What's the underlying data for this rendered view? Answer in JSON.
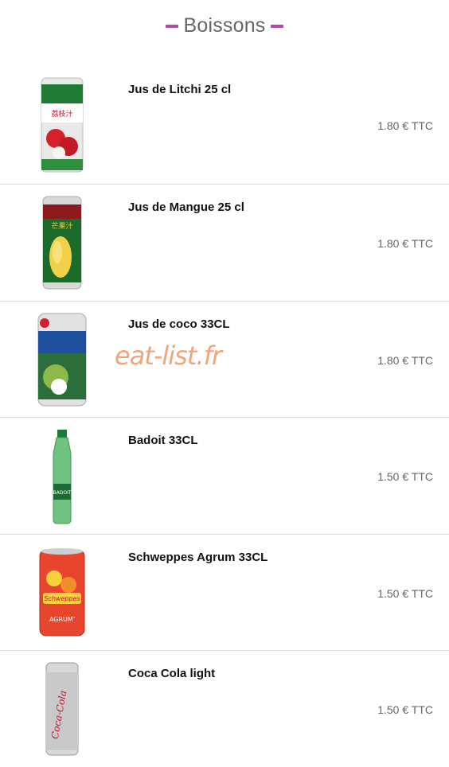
{
  "header": {
    "title": "Boissons"
  },
  "watermark": "eat-list.fr",
  "items": [
    {
      "name": "Jus de Litchi 25 cl",
      "price": "1.80 € TTC",
      "icon": "litchi-can-icon"
    },
    {
      "name": "Jus de Mangue 25 cl",
      "price": "1.80 € TTC",
      "icon": "mango-can-icon"
    },
    {
      "name": "Jus de coco 33CL",
      "price": "1.80 € TTC",
      "icon": "coconut-can-icon"
    },
    {
      "name": "Badoit 33CL",
      "price": "1.50 € TTC",
      "icon": "badoit-bottle-icon"
    },
    {
      "name": "Schweppes Agrum 33CL",
      "price": "1.50 € TTC",
      "icon": "schweppes-can-icon"
    },
    {
      "name": "Coca Cola light",
      "price": "1.50 € TTC",
      "icon": "coca-cola-light-can-icon"
    }
  ],
  "colors": {
    "accent": "#b04aa7",
    "watermark": "#f0a57c",
    "price": "#666666",
    "divider": "#dcdcdc"
  }
}
